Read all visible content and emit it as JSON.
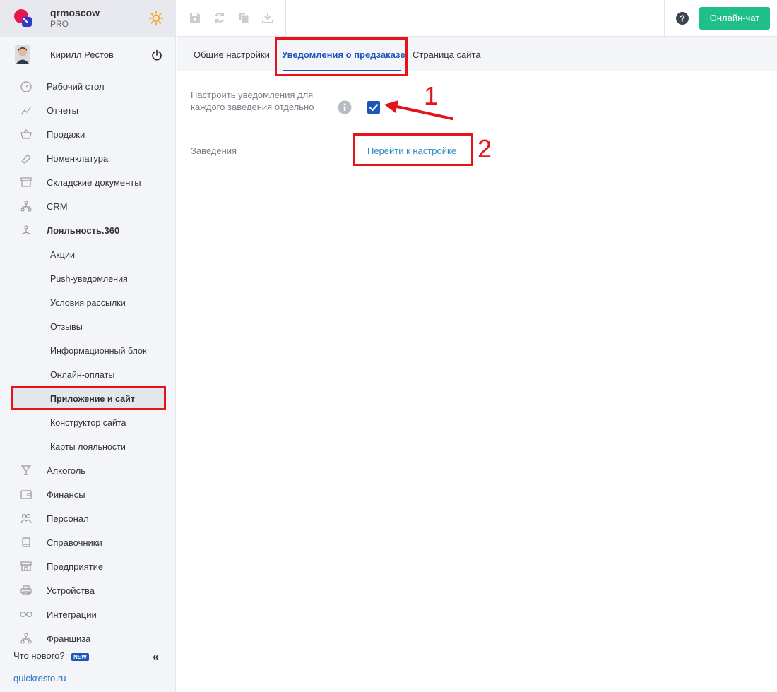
{
  "brand": {
    "name": "qrmoscow",
    "plan": "PRO"
  },
  "user": {
    "name": "Кирилл Рестов"
  },
  "nav": [
    {
      "label": "Рабочий стол",
      "icon": "dashboard-icon"
    },
    {
      "label": "Отчеты",
      "icon": "chart-icon"
    },
    {
      "label": "Продажи",
      "icon": "basket-icon"
    },
    {
      "label": "Номенклатура",
      "icon": "tag-icon"
    },
    {
      "label": "Складские документы",
      "icon": "archive-icon"
    },
    {
      "label": "CRM",
      "icon": "hierarchy-icon"
    },
    {
      "label": "Лояльность.360",
      "icon": "loyalty-icon"
    }
  ],
  "loyalty_sub": [
    "Акции",
    "Push-уведомления",
    "Условия рассылки",
    "Отзывы",
    "Информационный блок",
    "Онлайн-оплаты",
    "Приложение и сайт",
    "Конструктор сайта",
    "Карты лояльности"
  ],
  "nav_bottom": [
    {
      "label": "Алкоголь",
      "icon": "cocktail-icon"
    },
    {
      "label": "Финансы",
      "icon": "wallet-icon"
    },
    {
      "label": "Персонал",
      "icon": "people-icon"
    },
    {
      "label": "Справочники",
      "icon": "book-icon"
    },
    {
      "label": "Предприятие",
      "icon": "store-icon"
    },
    {
      "label": "Устройства",
      "icon": "printer-icon"
    },
    {
      "label": "Интеграции",
      "icon": "infinity-icon"
    },
    {
      "label": "Франшиза",
      "icon": "hierarchy-icon"
    }
  ],
  "footer": {
    "whats_new": "Что нового?",
    "badge": "NEW",
    "site": "quickresto.ru"
  },
  "toolbar": {
    "chat_label": "Онлайн-чат"
  },
  "tabs": [
    "Общие настройки",
    "Уведомления о предзаказе",
    "Страница сайта"
  ],
  "settings": {
    "per_venue_label": "Настроить уведомления для каждого заведения отдельно",
    "per_venue_checked": true,
    "venues_label": "Заведения",
    "venues_link": "Перейти к настройке"
  },
  "annotations": {
    "one": "1",
    "two": "2"
  },
  "colors": {
    "accent": "#1c56b8",
    "chat_button": "#1fbf8a",
    "highlight": "#e5141b"
  }
}
